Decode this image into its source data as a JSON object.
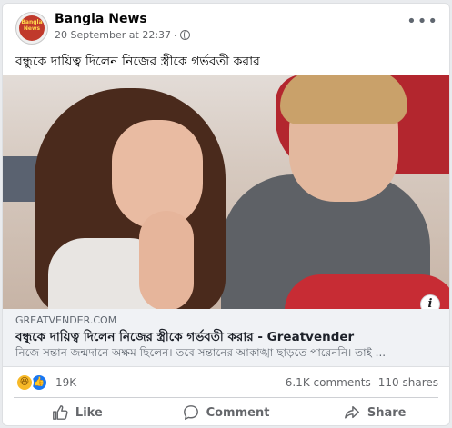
{
  "post": {
    "avatar_text": "Bangla News",
    "page_name": "Bangla News",
    "timestamp": "20 September at 22:37",
    "caption": "বন্ধুকে দায়িত্ব দিলেন নিজের স্ত্রীকে গর্ভবতী করার"
  },
  "link": {
    "domain": "GREATVENDER.COM",
    "title": "বন্ধুকে দায়িত্ব দিলেন নিজের স্ত্রীকে গর্ভবতী করার - Greatvender",
    "description": "নিজে সন্তান জন্মদানে অক্ষম ছিলেন। তবে সন্তানের আকাঙ্খা ছাড়তে পারেননি। তাই ..."
  },
  "engagement": {
    "reaction_count": "19K",
    "comments": "6.1K comments",
    "shares": "110 shares"
  },
  "actions": {
    "like": "Like",
    "comment": "Comment",
    "share": "Share"
  },
  "colors": {
    "accent": "#1877f2",
    "avatar_bg": "#c0392b",
    "text_secondary": "#65676b"
  }
}
